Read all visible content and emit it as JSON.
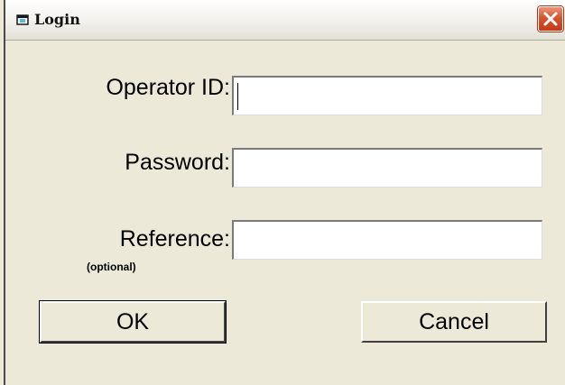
{
  "window": {
    "title": "Login",
    "app_icon": "window-app-icon",
    "close_icon": "close-icon"
  },
  "form": {
    "operator_id": {
      "label": "Operator ID:",
      "value": ""
    },
    "password": {
      "label": "Password:",
      "value": ""
    },
    "reference": {
      "label": "Reference:",
      "note": "(optional)",
      "value": ""
    }
  },
  "buttons": {
    "ok": "OK",
    "cancel": "Cancel"
  },
  "colors": {
    "dialog_bg": "#ece9d8",
    "close_button": "#d8542d"
  }
}
